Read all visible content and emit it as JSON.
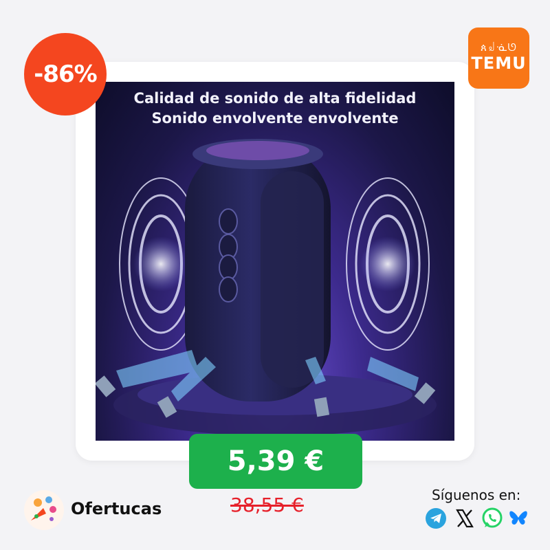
{
  "discount_badge": "-86%",
  "store": {
    "name": "TEMU",
    "glyphs": "ጰ꒻ᓍᘎ",
    "color": "#f87617"
  },
  "product": {
    "headline_line1": "Calidad de sonido de alta fidelidad",
    "headline_line2": "Sonido envolvente envolvente"
  },
  "price": {
    "current": "5,39 €",
    "original": "38,55 €"
  },
  "brand": {
    "name": "Ofertucas"
  },
  "social": {
    "label": "Síguenos en:",
    "icons": [
      "telegram-icon",
      "x-icon",
      "whatsapp-icon",
      "bluesky-icon"
    ]
  },
  "colors": {
    "badge": "#f4461f",
    "price_bg": "#1db04c",
    "old_price": "#e6202a"
  }
}
